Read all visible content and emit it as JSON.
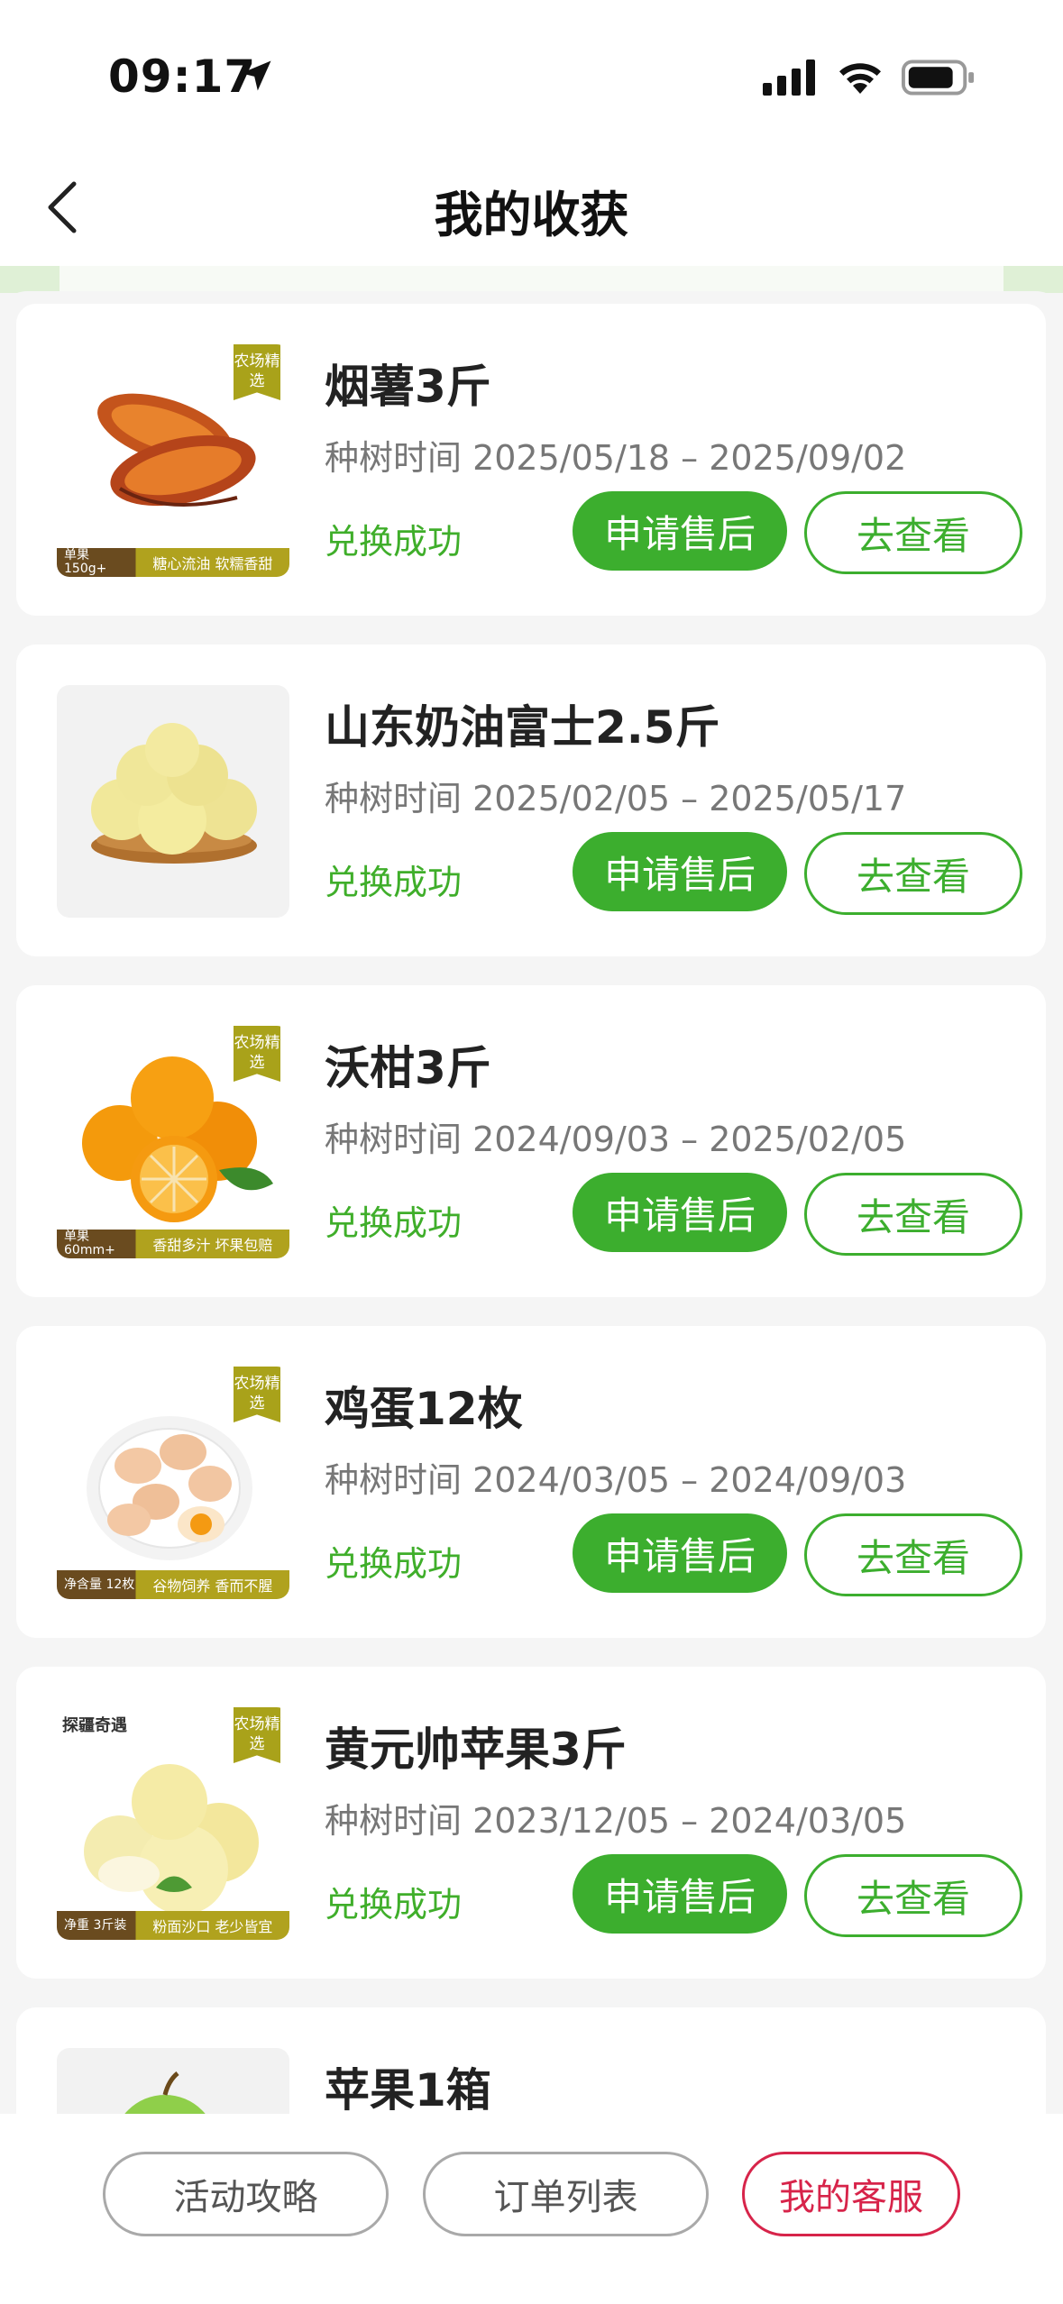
{
  "status_bar": {
    "time": "09:17"
  },
  "nav": {
    "title": "我的收获"
  },
  "items": [
    {
      "name": "烟薯3斤",
      "time": "种树时间 2025/05/18 – 2025/09/02",
      "status": "兑换成功",
      "btn_after": "申请售后",
      "btn_view": "去查看",
      "tag": "农场精选",
      "banner_left": "单果 150g+",
      "banner_right": "糖心流油  软糯香甜"
    },
    {
      "name": "山东奶油富士2.5斤",
      "time": "种树时间 2025/02/05 – 2025/05/17",
      "status": "兑换成功",
      "btn_after": "申请售后",
      "btn_view": "去查看"
    },
    {
      "name": "沃柑3斤",
      "time": "种树时间 2024/09/03 – 2025/02/05",
      "status": "兑换成功",
      "btn_after": "申请售后",
      "btn_view": "去查看",
      "tag": "农场精选",
      "banner_left": "单果 60mm+",
      "banner_right": "香甜多汁 坏果包赔"
    },
    {
      "name": "鸡蛋12枚",
      "time": "种树时间 2024/03/05 – 2024/09/03",
      "status": "兑换成功",
      "btn_after": "申请售后",
      "btn_view": "去查看",
      "tag": "农场精选",
      "banner_left": "净含量 12枚",
      "banner_right": "谷物饲养 香而不腥"
    },
    {
      "name": "黄元帅苹果3斤",
      "time": "种树时间 2023/12/05 – 2024/03/05",
      "status": "兑换成功",
      "btn_after": "申请售后",
      "btn_view": "去查看",
      "tag": "农场精选",
      "banner_left": "净重 3斤装",
      "banner_right": "粉面沙口 老少皆宜",
      "brand": "探疆奇遇"
    },
    {
      "name": "苹果1箱"
    }
  ],
  "bottom_bar": {
    "guide": "活动攻略",
    "orders": "订单列表",
    "service": "我的客服"
  },
  "colors": {
    "accent_green": "#3cae2e",
    "service_red": "#d7244a"
  }
}
